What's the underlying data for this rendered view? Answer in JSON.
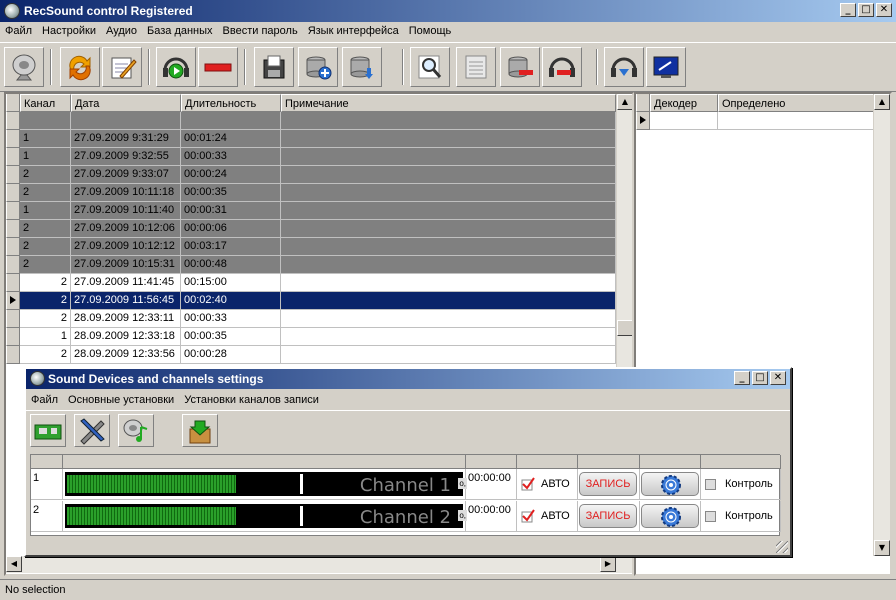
{
  "window": {
    "title": "RecSound control Registered",
    "btn_min": "_",
    "btn_max": "□",
    "btn_close": "✕"
  },
  "menu": [
    "Файл",
    "Настройки",
    "Аудио",
    "База данных",
    "Ввести пароль",
    "Язык интерфейса",
    "Помощь"
  ],
  "table": {
    "columns": [
      "Канал",
      "Дата",
      "Длительность",
      "Примечание"
    ],
    "rows": [
      {
        "ch": "",
        "date": "",
        "dur": "",
        "note": "",
        "state": "gray"
      },
      {
        "ch": "1",
        "date": "27.09.2009 9:31:29",
        "dur": "00:01:24",
        "note": "",
        "state": "gray"
      },
      {
        "ch": "1",
        "date": "27.09.2009 9:32:55",
        "dur": "00:00:33",
        "note": "",
        "state": "gray"
      },
      {
        "ch": "2",
        "date": "27.09.2009 9:33:07",
        "dur": "00:00:24",
        "note": "",
        "state": "gray"
      },
      {
        "ch": "2",
        "date": "27.09.2009 10:11:18",
        "dur": "00:00:35",
        "note": "",
        "state": "gray"
      },
      {
        "ch": "1",
        "date": "27.09.2009 10:11:40",
        "dur": "00:00:31",
        "note": "",
        "state": "gray"
      },
      {
        "ch": "2",
        "date": "27.09.2009 10:12:06",
        "dur": "00:00:06",
        "note": "",
        "state": "gray"
      },
      {
        "ch": "2",
        "date": "27.09.2009 10:12:12",
        "dur": "00:03:17",
        "note": "",
        "state": "gray"
      },
      {
        "ch": "2",
        "date": "27.09.2009 10:15:31",
        "dur": "00:00:48",
        "note": "",
        "state": "gray"
      },
      {
        "ch": "2",
        "date": "27.09.2009 11:41:45",
        "dur": "00:15:00",
        "note": "",
        "state": "normal"
      },
      {
        "ch": "2",
        "date": "27.09.2009 11:56:45",
        "dur": "00:02:40",
        "note": "",
        "state": "sel"
      },
      {
        "ch": "2",
        "date": "28.09.2009 12:33:11",
        "dur": "00:00:33",
        "note": "",
        "state": "normal"
      },
      {
        "ch": "1",
        "date": "28.09.2009 12:33:18",
        "dur": "00:00:35",
        "note": "",
        "state": "normal"
      },
      {
        "ch": "2",
        "date": "28.09.2009 12:33:56",
        "dur": "00:00:28",
        "note": "",
        "state": "normal"
      }
    ]
  },
  "decoder_table": {
    "columns": [
      "Декодер",
      "Определено"
    ]
  },
  "status": "No selection",
  "settings_window": {
    "title": "Sound Devices and channels settings",
    "menu": [
      "Файл",
      "Основные установки",
      "Установки каналов записи"
    ],
    "channels": [
      {
        "num": "1",
        "name": "Channel 1",
        "time": "00:00:00",
        "auto": "АВТО",
        "rec": "ЗАПИСЬ",
        "control": "Контроль",
        "level": 0.43,
        "marker": 0.59,
        "side_label": "о,"
      },
      {
        "num": "2",
        "name": "Channel 2",
        "time": "00:00:00",
        "auto": "АВТО",
        "rec": "ЗАПИСЬ",
        "control": "Контроль",
        "level": 0.43,
        "marker": 0.59,
        "side_label": "о,"
      }
    ]
  },
  "colors": {
    "selection": "#0a246a",
    "meter_green": "#2aa02a",
    "rec_text": "#e02020"
  }
}
